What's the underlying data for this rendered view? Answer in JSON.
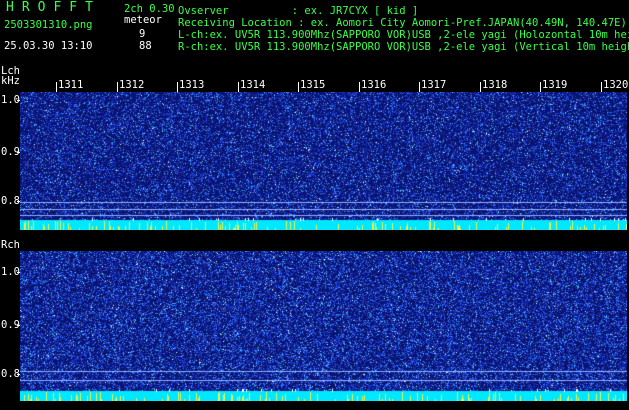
{
  "header": {
    "app_title": "HROFFT",
    "version": "2ch 0.30",
    "filename": "2503301310.png",
    "meteor_label": "meteor",
    "timestamp": "25.03.30 13:10",
    "meteor_count_l": "9",
    "meteor_count_r": "88",
    "observer": "Ovserver          : ex. JR7CYX [ kid ]",
    "location": "Receiving Location : ex. Aomori City Aomori-Pref.JAPAN(40.49N, 140.47E)",
    "lch_info": "L-ch:ex. UV5R 113.900Mhz(SAPPORO VOR)USB ,2-ele yagi (Holozontal 10m height)",
    "rch_info": "R-ch:ex. UV5R 113.900Mhz(SAPPORO VOR)USB ,2-ele yagi (Vertical 10m height)"
  },
  "lch": {
    "label": "Lch",
    "unit": "kHz",
    "yticks": [
      "1.0",
      "0.9",
      "0.8"
    ]
  },
  "rch": {
    "label": "Rch",
    "yticks": [
      "1.0",
      "0.9",
      "0.8"
    ]
  },
  "time_ticks": [
    "1311",
    "1312",
    "1313",
    "1314",
    "1315",
    "1316",
    "1317",
    "1318",
    "1319",
    "1320"
  ],
  "colors": {
    "background": "#000000",
    "text_green": "#39ff4a",
    "text_white": "#ffffff",
    "spectrogram_bg": "#0a1470",
    "baseline_cyan": "#00e8ff",
    "spike_yellow": "#f0f040"
  }
}
